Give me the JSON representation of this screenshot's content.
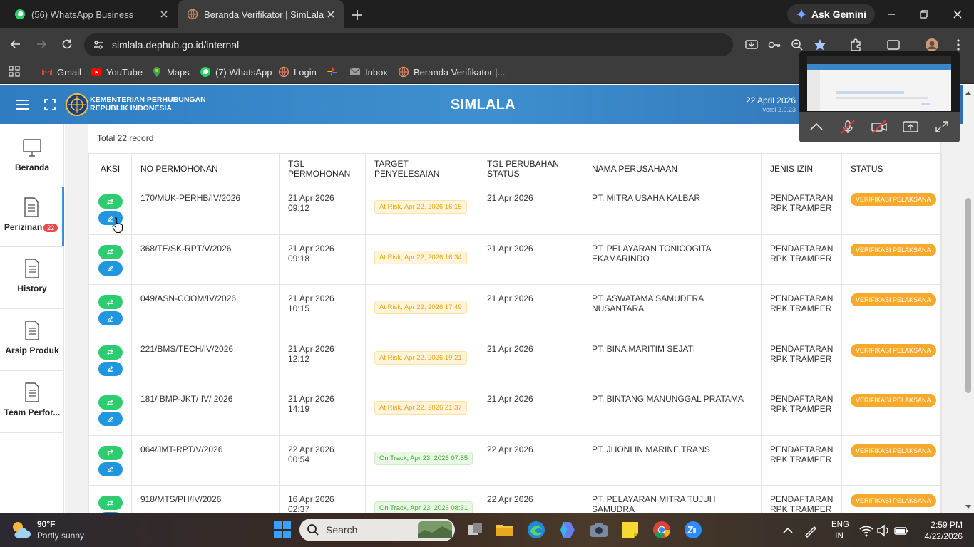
{
  "browser": {
    "tabs": [
      {
        "title": "(56) WhatsApp Business",
        "active": false
      },
      {
        "title": "Beranda Verifikator | SimLala",
        "active": true
      }
    ],
    "ask_gemini": "Ask Gemini",
    "url": "simlala.dephub.go.id/internal",
    "bookmarks": [
      "Gmail",
      "YouTube",
      "Maps",
      "(7) WhatsApp",
      "Login",
      "",
      "Inbox",
      "Beranda Verifikator |..."
    ]
  },
  "header": {
    "ministry_line1": "KEMENTERIAN PERHUBUNGAN",
    "ministry_line2": "REPUBLIK INDONESIA",
    "brand": "SIMLALA",
    "date": "22 April 2026",
    "version": "versi 2.0.23"
  },
  "sidebar": {
    "items": [
      {
        "label": "Beranda",
        "icon": "monitor-icon"
      },
      {
        "label": "Perizinan",
        "icon": "document-icon",
        "badge": "22",
        "active": true
      },
      {
        "label": "History",
        "icon": "document-icon"
      },
      {
        "label": "Arsip Produk",
        "icon": "document-icon"
      },
      {
        "label": "Team Perfor...",
        "icon": "document-icon"
      }
    ]
  },
  "table": {
    "total": "Total 22 record",
    "headers": [
      "AKSI",
      "NO PERMOHONAN",
      "TGL PERMOHONAN",
      "TARGET PENYELESAIAN",
      "TGL PERUBAHAN STATUS",
      "NAMA PERUSAHAAN",
      "JENIS IZIN",
      "STATUS"
    ],
    "rows": [
      {
        "no": "170/MUK-PERHB/IV/2026",
        "tgl": "21 Apr 2026 09:12",
        "target": "At Risk, Apr 22, 2026 16:15",
        "target_state": "risk",
        "ubah": "21 Apr 2026",
        "perusahaan": "PT. MITRA USAHA KALBAR",
        "jenis": "PENDAFTARAN RPK TRAMPER",
        "status": "VERIFIKASI PELAKSANA"
      },
      {
        "no": "368/TE/SK-RPT/V/2026",
        "tgl": "21 Apr 2026 09:18",
        "target": "At Risk, Apr 22, 2026 16:34",
        "target_state": "risk",
        "ubah": "21 Apr 2026",
        "perusahaan": "PT. PELAYARAN TONICOGITA EKAMARINDO",
        "jenis": "PENDAFTARAN RPK TRAMPER",
        "status": "VERIFIKASI PELAKSANA"
      },
      {
        "no": "049/ASN-COOM/IV/2026",
        "tgl": "21 Apr 2026 10:15",
        "target": "At Risk, Apr 22, 2026 17:49",
        "target_state": "risk",
        "ubah": "21 Apr 2026",
        "perusahaan": "PT. ASWATAMA SAMUDERA NUSANTARA",
        "jenis": "PENDAFTARAN RPK TRAMPER",
        "status": "VERIFIKASI PELAKSANA"
      },
      {
        "no": "221/BMS/TECH/IV/2026",
        "tgl": "21 Apr 2026 12:12",
        "target": "At Risk, Apr 22, 2026 19:21",
        "target_state": "risk",
        "ubah": "21 Apr 2026",
        "perusahaan": "PT. BINA MARITIM SEJATI",
        "jenis": "PENDAFTARAN RPK TRAMPER",
        "status": "VERIFIKASI PELAKSANA"
      },
      {
        "no": "181/ BMP-JKT/ IV/ 2026",
        "tgl": "21 Apr 2026 14:19",
        "target": "At Risk, Apr 22, 2026 21:37",
        "target_state": "risk",
        "ubah": "21 Apr 2026",
        "perusahaan": "PT. BINTANG MANUNGGAL PRATAMA",
        "jenis": "PENDAFTARAN RPK TRAMPER",
        "status": "VERIFIKASI PELAKSANA"
      },
      {
        "no": "064/JMT-RPT/V/2026",
        "tgl": "22 Apr 2026 00:54",
        "target": "On Track, Apr 23, 2026 07:55",
        "target_state": "track",
        "ubah": "22 Apr 2026",
        "perusahaan": "PT. JHONLIN MARINE TRANS",
        "jenis": "PENDAFTARAN RPK TRAMPER",
        "status": "VERIFIKASI PELAKSANA"
      },
      {
        "no": "918/MTS/PH/IV/2026",
        "tgl": "16 Apr 2026 02:37",
        "target": "On Track, Apr 23, 2026 08:31",
        "target_state": "track",
        "ubah": "22 Apr 2026",
        "perusahaan": "PT. PELAYARAN MITRA TUJUH SAMUDRA",
        "jenis": "PENDAFTARAN RPK TRAMPER",
        "status": "VERIFIKASI PELAKSANA"
      }
    ]
  },
  "taskbar": {
    "temp": "90°F",
    "weather": "Partly sunny",
    "search": "Search",
    "lang1": "ENG",
    "lang2": "IN",
    "time": "2:59 PM",
    "date": "4/22/2026"
  },
  "colors": {
    "header_blue": "#3e8fd0",
    "status_orange": "#f6a92b",
    "risk_text": "#e8a317",
    "track_text": "#3aaa2e",
    "btn_green": "#2ecc71",
    "btn_blue": "#2196e0"
  }
}
